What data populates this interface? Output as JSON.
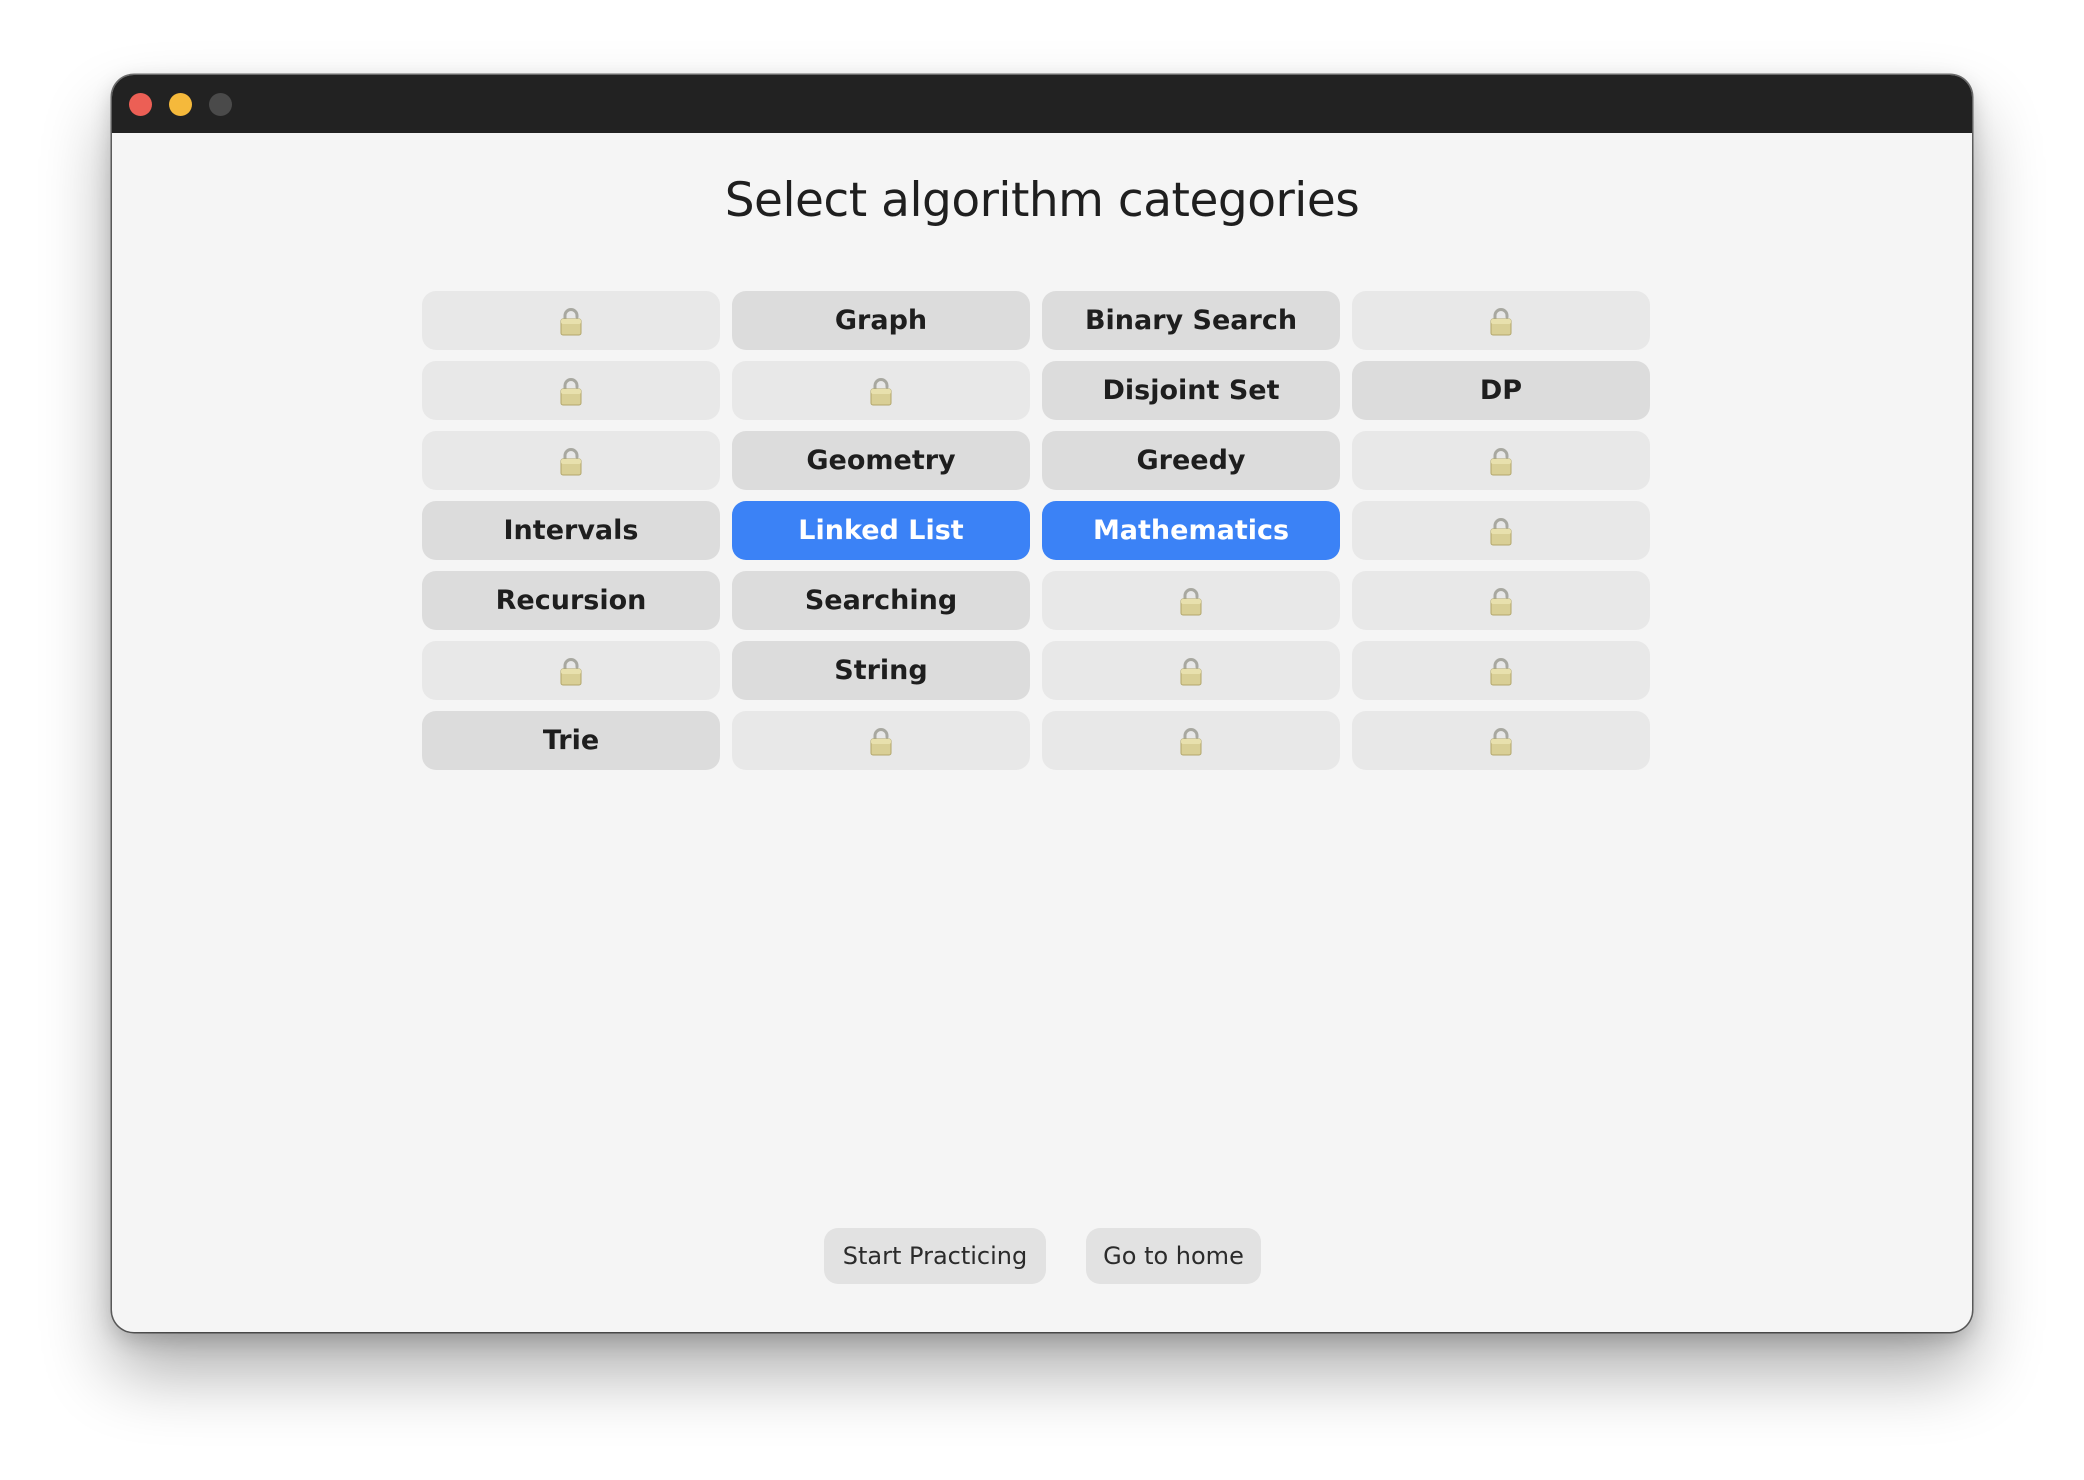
{
  "window": {
    "traffic_lights": {
      "close_color": "#ec5f55",
      "minimize_color": "#f5b93b",
      "zoom_color": "#4a4a4a"
    }
  },
  "page": {
    "title": "Select algorithm categories"
  },
  "categories": [
    {
      "label": "",
      "state": "locked",
      "icon": "lock-icon"
    },
    {
      "label": "Graph",
      "state": "available"
    },
    {
      "label": "Binary Search",
      "state": "available"
    },
    {
      "label": "",
      "state": "locked",
      "icon": "lock-icon"
    },
    {
      "label": "",
      "state": "locked",
      "icon": "lock-icon"
    },
    {
      "label": "",
      "state": "locked",
      "icon": "lock-icon"
    },
    {
      "label": "Disjoint Set",
      "state": "available"
    },
    {
      "label": "DP",
      "state": "available"
    },
    {
      "label": "",
      "state": "locked",
      "icon": "lock-icon"
    },
    {
      "label": "Geometry",
      "state": "available"
    },
    {
      "label": "Greedy",
      "state": "available"
    },
    {
      "label": "",
      "state": "locked",
      "icon": "lock-icon"
    },
    {
      "label": "Intervals",
      "state": "available"
    },
    {
      "label": "Linked List",
      "state": "selected"
    },
    {
      "label": "Mathematics",
      "state": "selected"
    },
    {
      "label": "",
      "state": "locked",
      "icon": "lock-icon"
    },
    {
      "label": "Recursion",
      "state": "available"
    },
    {
      "label": "Searching",
      "state": "available"
    },
    {
      "label": "",
      "state": "locked",
      "icon": "lock-icon"
    },
    {
      "label": "",
      "state": "locked",
      "icon": "lock-icon"
    },
    {
      "label": "",
      "state": "locked",
      "icon": "lock-icon"
    },
    {
      "label": "String",
      "state": "available"
    },
    {
      "label": "",
      "state": "locked",
      "icon": "lock-icon"
    },
    {
      "label": "",
      "state": "locked",
      "icon": "lock-icon"
    },
    {
      "label": "Trie",
      "state": "available"
    },
    {
      "label": "",
      "state": "locked",
      "icon": "lock-icon"
    },
    {
      "label": "",
      "state": "locked",
      "icon": "lock-icon"
    },
    {
      "label": "",
      "state": "locked",
      "icon": "lock-icon"
    }
  ],
  "footer": {
    "start_label": "Start Practicing",
    "home_label": "Go to home"
  },
  "colors": {
    "selected": "#3b82f6",
    "available": "#dcdcdc",
    "locked": "#e8e8e8"
  }
}
